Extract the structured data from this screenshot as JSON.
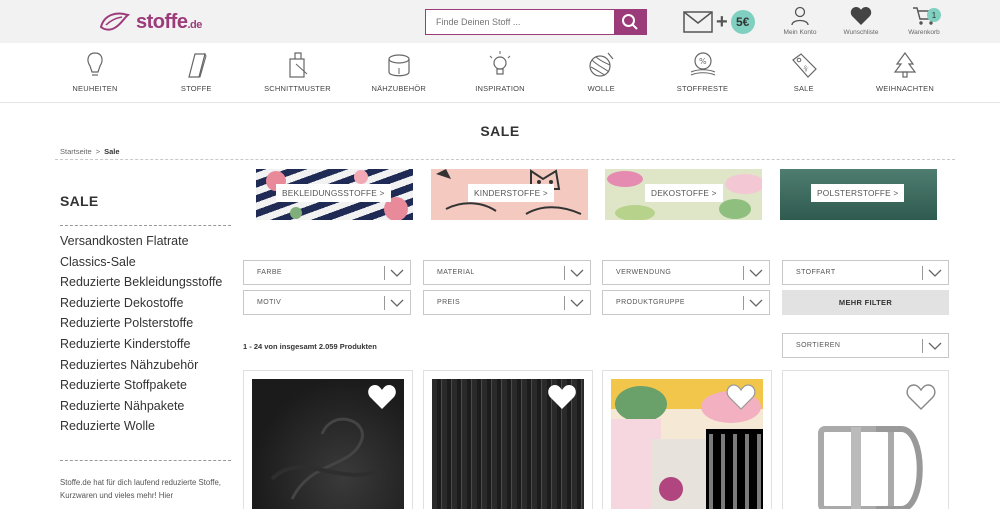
{
  "brand": {
    "name": "stoffe",
    "tld": ".de"
  },
  "search": {
    "placeholder": "Finde Deinen Stoff ..."
  },
  "promo": {
    "amount": "5€"
  },
  "header_actions": {
    "account": "Mein Konto",
    "wishlist": "Wunschliste",
    "cart": "Warenkorb",
    "cart_count": "1"
  },
  "categories": [
    {
      "label": "NEUHEITEN",
      "icon": "bulb-icon"
    },
    {
      "label": "STOFFE",
      "icon": "fabric-icon"
    },
    {
      "label": "SCHNITTMUSTER",
      "icon": "pattern-icon"
    },
    {
      "label": "NÄHZUBEHÖR",
      "icon": "measuring-tape-icon"
    },
    {
      "label": "INSPIRATION",
      "icon": "lightbulb-icon"
    },
    {
      "label": "WOLLE",
      "icon": "yarn-icon"
    },
    {
      "label": "STOFFRESTE",
      "icon": "fabric-remnants-icon"
    },
    {
      "label": "SALE",
      "icon": "price-tag-icon"
    },
    {
      "label": "WEIHNACHTEN",
      "icon": "christmas-tree-icon"
    }
  ],
  "page": {
    "title": "SALE"
  },
  "breadcrumb": {
    "home": "Startseite",
    "sep": ">",
    "current": "Sale"
  },
  "sidebar": {
    "title": "SALE",
    "items": [
      "Versandkosten Flatrate",
      "Classics-Sale",
      "Reduzierte Bekleidungsstoffe",
      "Reduzierte Dekostoffe",
      "Reduzierte Polsterstoffe",
      "Reduzierte Kinderstoffe",
      "Reduziertes Nähzubehör",
      "Reduzierte Stoffpakete",
      "Reduzierte Nähpakete",
      "Reduzierte Wolle"
    ],
    "description": "Stoffe.de hat für dich laufend reduzierte Stoffe, Kurzwaren und vieles mehr! Hier"
  },
  "banners": [
    {
      "label": "BEKLEIDUNGSSTOFFE >"
    },
    {
      "label": "KINDERSTOFFE >"
    },
    {
      "label": "DEKOSTOFFE >"
    },
    {
      "label": "POLSTERSTOFFE >"
    }
  ],
  "filters": [
    {
      "label": "FARBE"
    },
    {
      "label": "MATERIAL"
    },
    {
      "label": "VERWENDUNG"
    },
    {
      "label": "STOFFART"
    },
    {
      "label": "MOTIV"
    },
    {
      "label": "PREIS"
    },
    {
      "label": "PRODUKTGRUPPE"
    }
  ],
  "more_filter": "MEHR FILTER",
  "results": {
    "text": "1 - 24 von insgesamt 2.059 Produkten"
  },
  "sort": {
    "label": "SORTIEREN"
  },
  "colors": {
    "brand": "#9c3b7a",
    "accent": "#7fd0c0"
  }
}
